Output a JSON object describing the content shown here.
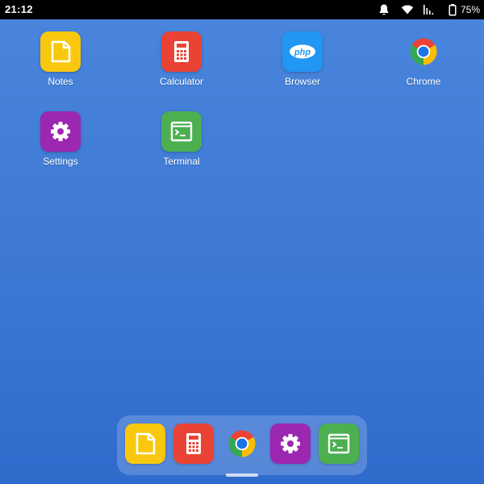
{
  "status_bar": {
    "time": "21:12",
    "battery_percent": "75%",
    "icons": [
      "notification-bell-icon",
      "wifi-icon",
      "cell-signal-icon",
      "battery-icon"
    ]
  },
  "apps": [
    {
      "label": "Notes",
      "icon": "notes-icon",
      "color": "#f9c80e"
    },
    {
      "label": "Calculator",
      "icon": "calculator-icon",
      "color": "#ea4335"
    },
    {
      "label": "Browser",
      "icon": "php-icon",
      "color": "#2196f3"
    },
    {
      "label": "Chrome",
      "icon": "chrome-icon",
      "color": "#ffffff"
    },
    {
      "label": "Settings",
      "icon": "gear-icon",
      "color": "#9c27b0"
    },
    {
      "label": "Terminal",
      "icon": "terminal-icon",
      "color": "#4caf50"
    }
  ],
  "dock": [
    {
      "icon": "notes-icon",
      "color": "#f9c80e"
    },
    {
      "icon": "calculator-icon",
      "color": "#ea4335"
    },
    {
      "icon": "chrome-icon",
      "color": "#ffffff"
    },
    {
      "icon": "gear-icon",
      "color": "#9c27b0"
    },
    {
      "icon": "terminal-icon",
      "color": "#4caf50"
    }
  ]
}
